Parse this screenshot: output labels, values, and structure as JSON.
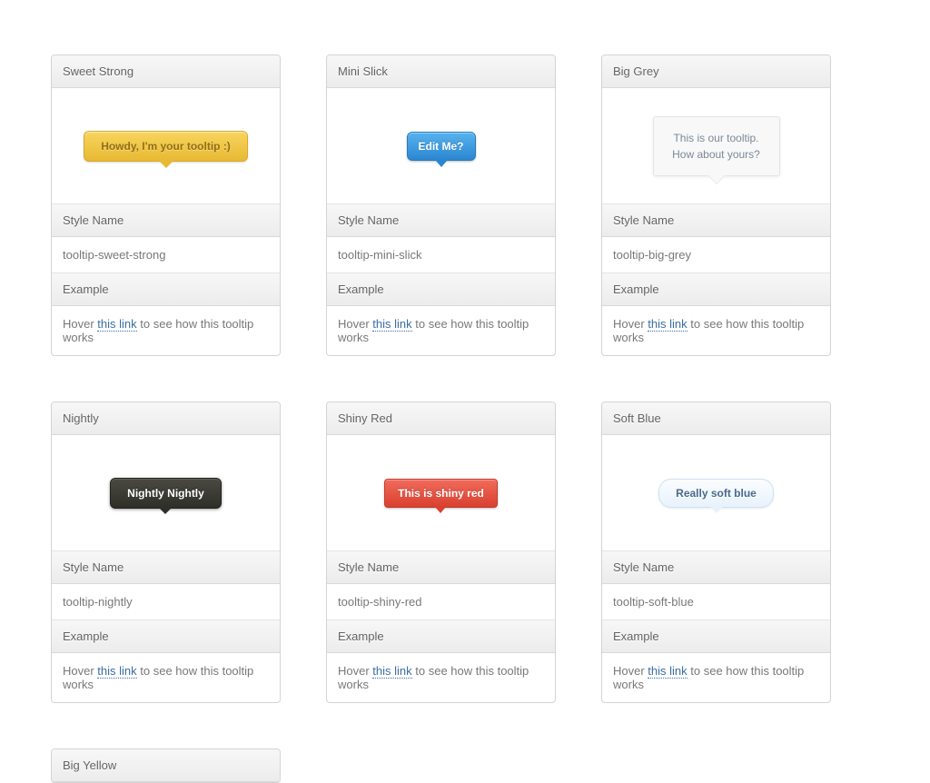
{
  "labels": {
    "style_name": "Style Name",
    "example": "Example",
    "hover_prefix": "Hover ",
    "hover_link": "this link",
    "hover_suffix": " to see how this tooltip works"
  },
  "cards": [
    {
      "title": "Sweet Strong",
      "tooltip_text": "Howdy, I'm your tooltip :)",
      "style_class": "tooltip-sweet-strong",
      "bubble_class": "sweet-strong"
    },
    {
      "title": "Mini Slick",
      "tooltip_text": "Edit Me?",
      "style_class": "tooltip-mini-slick",
      "bubble_class": "mini-slick"
    },
    {
      "title": "Big Grey",
      "tooltip_text": "This is our tooltip. How about yours?",
      "style_class": "tooltip-big-grey",
      "bubble_class": "big-grey"
    },
    {
      "title": "Nightly",
      "tooltip_text": "Nightly Nightly",
      "style_class": "tooltip-nightly",
      "bubble_class": "nightly"
    },
    {
      "title": "Shiny Red",
      "tooltip_text": "This is shiny red",
      "style_class": "tooltip-shiny-red",
      "bubble_class": "shiny-red"
    },
    {
      "title": "Soft Blue",
      "tooltip_text": "Really soft blue",
      "style_class": "tooltip-soft-blue",
      "bubble_class": "soft-blue"
    },
    {
      "title": "Big Yellow",
      "tooltip_text": "",
      "style_class": "tooltip-big-yellow",
      "bubble_class": "big-yellow",
      "partial": true
    }
  ]
}
